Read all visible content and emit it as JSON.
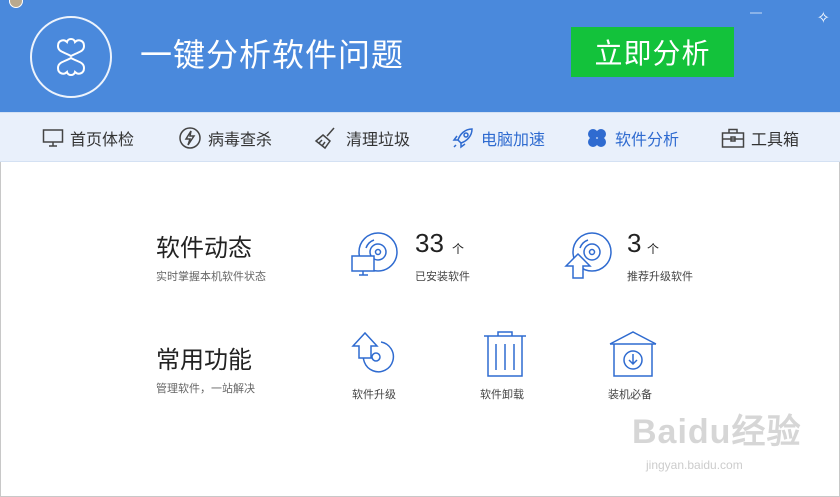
{
  "banner": {
    "title": "一键分析软件问题",
    "analyze_button": "立即分析"
  },
  "nav": {
    "items": [
      {
        "label": "首页体检",
        "icon": "monitor-icon"
      },
      {
        "label": "病毒查杀",
        "icon": "lightning-shield-icon"
      },
      {
        "label": "清理垃圾",
        "icon": "broom-icon"
      },
      {
        "label": "电脑加速",
        "icon": "rocket-icon"
      },
      {
        "label": "软件分析",
        "icon": "clover-icon"
      },
      {
        "label": "工具箱",
        "icon": "toolbox-icon"
      }
    ]
  },
  "software_dynamics": {
    "title": "软件动态",
    "subtitle": "实时掌握本机软件状态",
    "installed": {
      "count": "33",
      "unit": "个",
      "label": "已安装软件"
    },
    "recommended_upgrade": {
      "count": "3",
      "unit": "个",
      "label": "推荐升级软件"
    }
  },
  "common_functions": {
    "title": "常用功能",
    "subtitle": "管理软件，一站解决",
    "tools": [
      {
        "label": "软件升级",
        "icon": "upgrade-icon"
      },
      {
        "label": "软件卸载",
        "icon": "trash-icon"
      },
      {
        "label": "装机必备",
        "icon": "box-download-icon"
      }
    ]
  },
  "watermark": {
    "brand": "Baidu经验",
    "url": "jingyan.baidu.com"
  },
  "colors": {
    "banner": "#4a89dc",
    "accent_green": "#13c23b",
    "nav_bg": "#e9f0fb",
    "icon_blue": "#2f6bd0"
  }
}
